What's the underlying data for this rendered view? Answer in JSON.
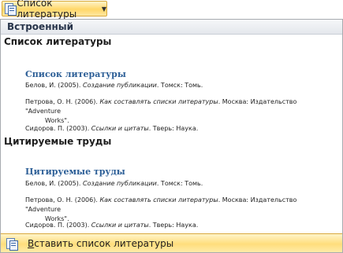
{
  "dropdown": {
    "label": "Список литературы",
    "icon": "bibliography-icon",
    "chevron_icon": "chevron-down-icon"
  },
  "gallery": {
    "section_header": "Встроенный",
    "items": [
      {
        "title": "Список литературы",
        "preview": {
          "heading": "Список литературы",
          "citations": [
            {
              "author": "Белов, И. (2005). ",
              "work": "Создание публикации",
              "rest": ". Томск: Томь.",
              "cont": ""
            },
            {
              "author": "Петрова, О. Н. (2006). ",
              "work": "Как составлять списки литературы",
              "rest": ". Москва: Издательство \"Adventure",
              "cont": "Works\"."
            },
            {
              "author": "Сидоров. П. (2003). ",
              "work": "Ссылки и цитаты",
              "rest": ". Тверь: Наука.",
              "cont": ""
            }
          ]
        }
      },
      {
        "title": "Цитируемые труды",
        "preview": {
          "heading": "Цитируемые труды",
          "citations": [
            {
              "author": "Белов, И. (2005). ",
              "work": "Создание публикации",
              "rest": ". Томск: Томь.",
              "cont": ""
            },
            {
              "author": "Петрова, О. Н. (2006). ",
              "work": "Как составлять списки литературы",
              "rest": ". Москва: Издательство \"Adventure",
              "cont": "Works\"."
            },
            {
              "author": "Сидоров. П. (2003). ",
              "work": "Ссылки и цитаты",
              "rest": ". Тверь: Наука.",
              "cont": ""
            }
          ]
        }
      }
    ]
  },
  "insert_command": {
    "mnemonic": "В",
    "label_rest": "ставить список литературы",
    "icon": "insert-bibliography-icon"
  }
}
